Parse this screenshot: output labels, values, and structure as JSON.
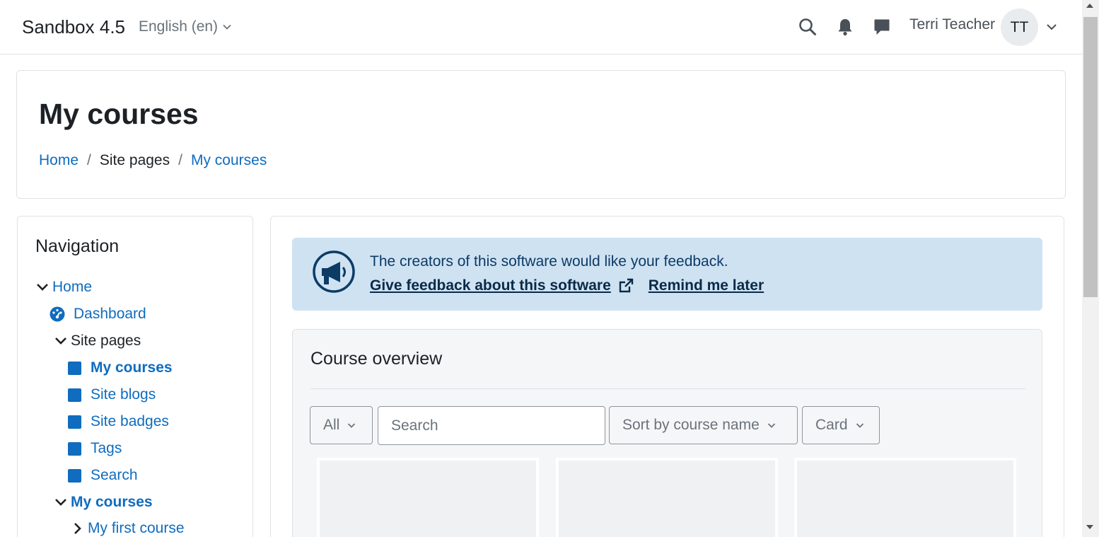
{
  "navbar": {
    "brand": "Sandbox 4.5",
    "language": "English (en)",
    "user_name": "Terri Teacher",
    "avatar_initials": "TT",
    "icons": [
      "search-icon",
      "bell-icon",
      "messages-icon",
      "chevron-down-icon"
    ]
  },
  "header": {
    "title": "My courses",
    "breadcrumb": [
      {
        "label": "Home",
        "link": true
      },
      {
        "label": "Site pages",
        "link": false
      },
      {
        "label": "My courses",
        "link": true
      }
    ],
    "separator": "/"
  },
  "navigation": {
    "title": "Navigation",
    "items": {
      "home": "Home",
      "dashboard": "Dashboard",
      "site_pages": "Site pages",
      "my_courses_link": "My courses",
      "site_blogs": "Site blogs",
      "site_badges": "Site badges",
      "tags": "Tags",
      "search": "Search",
      "my_courses_node": "My courses",
      "my_first_course": "My first course"
    }
  },
  "feedback": {
    "message": "The creators of this software would like your feedback.",
    "give_feedback": "Give feedback about this software",
    "remind_later": "Remind me later"
  },
  "course_overview": {
    "title": "Course overview",
    "filter_value": "All",
    "search_placeholder": "Search",
    "sort_value": "Sort by course name",
    "view_value": "Card"
  },
  "colors": {
    "link": "#0f6cbf",
    "feedback_bg": "#cfe2f2",
    "feedback_text": "#0c3b66",
    "border": "#dee2e6"
  }
}
